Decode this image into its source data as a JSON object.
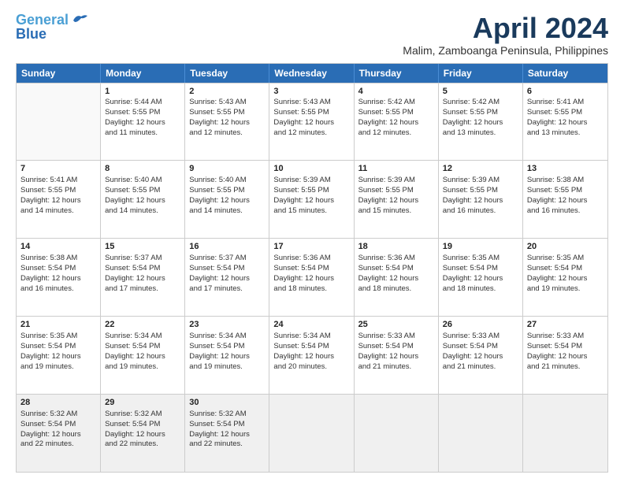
{
  "logo": {
    "line1": "General",
    "line2": "Blue"
  },
  "title": "April 2024",
  "subtitle": "Malim, Zamboanga Peninsula, Philippines",
  "weekdays": [
    "Sunday",
    "Monday",
    "Tuesday",
    "Wednesday",
    "Thursday",
    "Friday",
    "Saturday"
  ],
  "weeks": [
    [
      {
        "day": "",
        "empty": true
      },
      {
        "day": "1",
        "sunrise": "5:44 AM",
        "sunset": "5:55 PM",
        "daylight": "12 hours and 11 minutes."
      },
      {
        "day": "2",
        "sunrise": "5:43 AM",
        "sunset": "5:55 PM",
        "daylight": "12 hours and 12 minutes."
      },
      {
        "day": "3",
        "sunrise": "5:43 AM",
        "sunset": "5:55 PM",
        "daylight": "12 hours and 12 minutes."
      },
      {
        "day": "4",
        "sunrise": "5:42 AM",
        "sunset": "5:55 PM",
        "daylight": "12 hours and 12 minutes."
      },
      {
        "day": "5",
        "sunrise": "5:42 AM",
        "sunset": "5:55 PM",
        "daylight": "12 hours and 13 minutes."
      },
      {
        "day": "6",
        "sunrise": "5:41 AM",
        "sunset": "5:55 PM",
        "daylight": "12 hours and 13 minutes."
      }
    ],
    [
      {
        "day": "7",
        "sunrise": "5:41 AM",
        "sunset": "5:55 PM",
        "daylight": "12 hours and 14 minutes."
      },
      {
        "day": "8",
        "sunrise": "5:40 AM",
        "sunset": "5:55 PM",
        "daylight": "12 hours and 14 minutes."
      },
      {
        "day": "9",
        "sunrise": "5:40 AM",
        "sunset": "5:55 PM",
        "daylight": "12 hours and 14 minutes."
      },
      {
        "day": "10",
        "sunrise": "5:39 AM",
        "sunset": "5:55 PM",
        "daylight": "12 hours and 15 minutes."
      },
      {
        "day": "11",
        "sunrise": "5:39 AM",
        "sunset": "5:55 PM",
        "daylight": "12 hours and 15 minutes."
      },
      {
        "day": "12",
        "sunrise": "5:39 AM",
        "sunset": "5:55 PM",
        "daylight": "12 hours and 16 minutes."
      },
      {
        "day": "13",
        "sunrise": "5:38 AM",
        "sunset": "5:55 PM",
        "daylight": "12 hours and 16 minutes."
      }
    ],
    [
      {
        "day": "14",
        "sunrise": "5:38 AM",
        "sunset": "5:54 PM",
        "daylight": "12 hours and 16 minutes."
      },
      {
        "day": "15",
        "sunrise": "5:37 AM",
        "sunset": "5:54 PM",
        "daylight": "12 hours and 17 minutes."
      },
      {
        "day": "16",
        "sunrise": "5:37 AM",
        "sunset": "5:54 PM",
        "daylight": "12 hours and 17 minutes."
      },
      {
        "day": "17",
        "sunrise": "5:36 AM",
        "sunset": "5:54 PM",
        "daylight": "12 hours and 18 minutes."
      },
      {
        "day": "18",
        "sunrise": "5:36 AM",
        "sunset": "5:54 PM",
        "daylight": "12 hours and 18 minutes."
      },
      {
        "day": "19",
        "sunrise": "5:35 AM",
        "sunset": "5:54 PM",
        "daylight": "12 hours and 18 minutes."
      },
      {
        "day": "20",
        "sunrise": "5:35 AM",
        "sunset": "5:54 PM",
        "daylight": "12 hours and 19 minutes."
      }
    ],
    [
      {
        "day": "21",
        "sunrise": "5:35 AM",
        "sunset": "5:54 PM",
        "daylight": "12 hours and 19 minutes."
      },
      {
        "day": "22",
        "sunrise": "5:34 AM",
        "sunset": "5:54 PM",
        "daylight": "12 hours and 19 minutes."
      },
      {
        "day": "23",
        "sunrise": "5:34 AM",
        "sunset": "5:54 PM",
        "daylight": "12 hours and 19 minutes."
      },
      {
        "day": "24",
        "sunrise": "5:34 AM",
        "sunset": "5:54 PM",
        "daylight": "12 hours and 20 minutes."
      },
      {
        "day": "25",
        "sunrise": "5:33 AM",
        "sunset": "5:54 PM",
        "daylight": "12 hours and 21 minutes."
      },
      {
        "day": "26",
        "sunrise": "5:33 AM",
        "sunset": "5:54 PM",
        "daylight": "12 hours and 21 minutes."
      },
      {
        "day": "27",
        "sunrise": "5:33 AM",
        "sunset": "5:54 PM",
        "daylight": "12 hours and 21 minutes."
      }
    ],
    [
      {
        "day": "28",
        "sunrise": "5:32 AM",
        "sunset": "5:54 PM",
        "daylight": "12 hours and 22 minutes."
      },
      {
        "day": "29",
        "sunrise": "5:32 AM",
        "sunset": "5:54 PM",
        "daylight": "12 hours and 22 minutes."
      },
      {
        "day": "30",
        "sunrise": "5:32 AM",
        "sunset": "5:54 PM",
        "daylight": "12 hours and 22 minutes."
      },
      {
        "day": "",
        "empty": true
      },
      {
        "day": "",
        "empty": true
      },
      {
        "day": "",
        "empty": true
      },
      {
        "day": "",
        "empty": true
      }
    ]
  ],
  "labels": {
    "sunrise": "Sunrise:",
    "sunset": "Sunset:",
    "daylight": "Daylight:"
  }
}
